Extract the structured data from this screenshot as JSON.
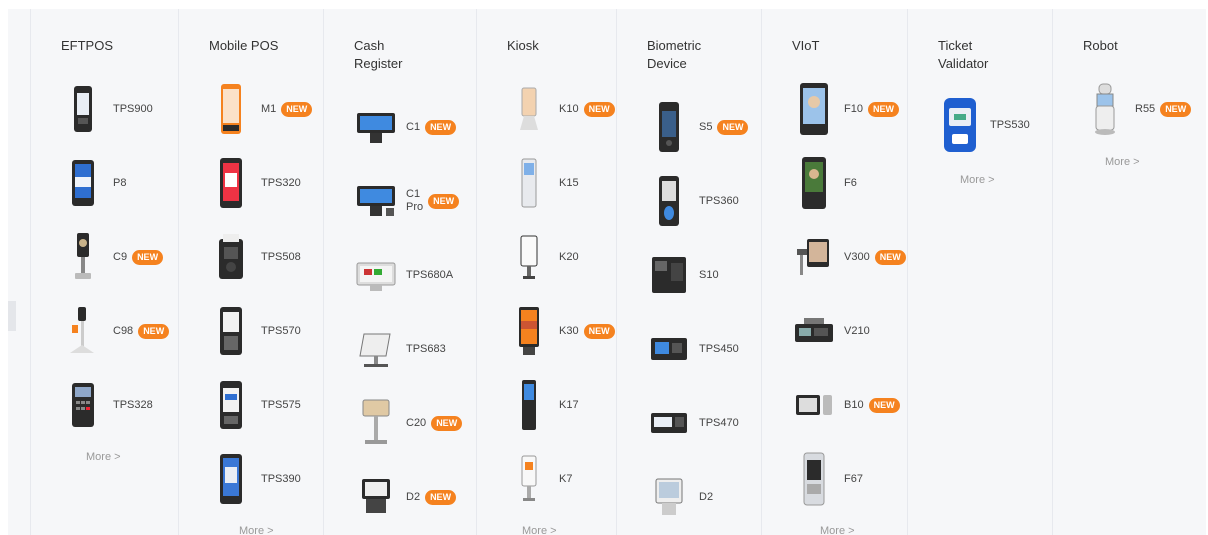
{
  "columns": [
    {
      "title": "EFTPOS",
      "more": "More >",
      "items": [
        {
          "label": "TPS900",
          "badge": ""
        },
        {
          "label": "P8",
          "badge": ""
        },
        {
          "label": "C9",
          "badge": "NEW"
        },
        {
          "label": "C98",
          "badge": "NEW"
        },
        {
          "label": "TPS328",
          "badge": ""
        }
      ]
    },
    {
      "title": "Mobile POS",
      "more": "More >",
      "items": [
        {
          "label": "M1",
          "badge": "NEW"
        },
        {
          "label": "TPS320",
          "badge": ""
        },
        {
          "label": "TPS508",
          "badge": ""
        },
        {
          "label": "TPS570",
          "badge": ""
        },
        {
          "label": "TPS575",
          "badge": ""
        },
        {
          "label": "TPS390",
          "badge": ""
        }
      ]
    },
    {
      "title": "Cash\nRegister",
      "more": "",
      "items": [
        {
          "label": "C1",
          "badge": "NEW"
        },
        {
          "label": "C1\nPro",
          "badge": "NEW"
        },
        {
          "label": "TPS680A",
          "badge": ""
        },
        {
          "label": "TPS683",
          "badge": ""
        },
        {
          "label": "C20",
          "badge": "NEW"
        },
        {
          "label": "D2",
          "badge": "NEW"
        }
      ]
    },
    {
      "title": "Kiosk",
      "more": "More >",
      "items": [
        {
          "label": "K10",
          "badge": "NEW"
        },
        {
          "label": "K15",
          "badge": ""
        },
        {
          "label": "K20",
          "badge": ""
        },
        {
          "label": "K30",
          "badge": "NEW"
        },
        {
          "label": "K17",
          "badge": ""
        },
        {
          "label": "K7",
          "badge": ""
        }
      ]
    },
    {
      "title": "Biometric\nDevice",
      "more": "",
      "items": [
        {
          "label": "S5",
          "badge": "NEW"
        },
        {
          "label": "TPS360",
          "badge": ""
        },
        {
          "label": "S10",
          "badge": ""
        },
        {
          "label": "TPS450",
          "badge": ""
        },
        {
          "label": "TPS470",
          "badge": ""
        },
        {
          "label": "D2",
          "badge": ""
        }
      ]
    },
    {
      "title": "VIoT",
      "more": "More >",
      "items": [
        {
          "label": "F10",
          "badge": "NEW"
        },
        {
          "label": "F6",
          "badge": ""
        },
        {
          "label": "V300",
          "badge": "NEW"
        },
        {
          "label": "V210",
          "badge": ""
        },
        {
          "label": "B10",
          "badge": "NEW"
        },
        {
          "label": "F67",
          "badge": ""
        }
      ]
    },
    {
      "title": "Ticket\nValidator",
      "more": "More >",
      "items": [
        {
          "label": "TPS530",
          "badge": ""
        }
      ]
    },
    {
      "title": "Robot",
      "more": "More >",
      "items": [
        {
          "label": "R55",
          "badge": "NEW"
        }
      ]
    }
  ],
  "colors": {
    "badge": "#f5821f",
    "panel": "#f6f7f9",
    "device_dark": "#2b2b2b",
    "screen_blue": "#2f6fd1"
  }
}
